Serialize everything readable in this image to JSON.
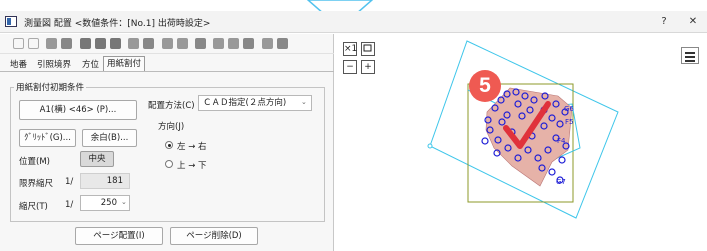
{
  "window": {
    "title": "測量図 配置 <数値条件：[No.1] 出荷時設定>",
    "help": "?",
    "close": "✕"
  },
  "tabs": [
    "地番",
    "引照境界",
    "方位",
    "用紙割付"
  ],
  "group": {
    "label": "用紙割付初期条件",
    "paper_button": "A1(横) <46> (P)...",
    "grid_button": "ｸﾞﾘｯﾄﾞ(G)...",
    "margin_button": "余白(B)...",
    "position_label": "位置(M)",
    "position_value": "中央",
    "limit_scale_label": "限界縮尺",
    "limit_scale_prefix": "1/",
    "limit_scale_value": "181",
    "scale_label": "縮尺(T)",
    "scale_prefix": "1/",
    "scale_value": "250",
    "method_label": "配置方法(C)",
    "method_value": "ＣＡＤ指定(２点方向)",
    "direction_label": "方向(J)",
    "direction_options": [
      "左 → 右",
      "上 → 下"
    ],
    "direction_selected": 0
  },
  "bottom": {
    "page_place_button": "ページ配置(I)",
    "page_delete_button": "ページ削除(D)"
  },
  "canvas": {
    "zoom_fit": "×1",
    "zoom_out": "−",
    "zoom_in": "+",
    "menu": "☰",
    "step_badge": "5",
    "point_labels": [
      "G6",
      "F5",
      "F4",
      "G7"
    ]
  },
  "colors": {
    "accent": "#52c2ee",
    "badge": "#ef5a52",
    "check": "#e0323b",
    "parcel_lines": "#1f1fd6",
    "boundary": "#8c9a2a",
    "rotated_frame": "#3fc6ea"
  }
}
